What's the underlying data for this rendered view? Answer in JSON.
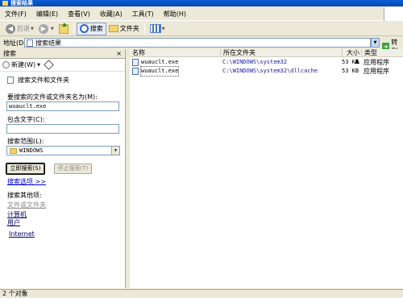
{
  "window": {
    "title": "搜索结果"
  },
  "menu": [
    "文件(F)",
    "编辑(E)",
    "查看(V)",
    "收藏(A)",
    "工具(T)",
    "帮助(H)"
  ],
  "toolbar": {
    "back": "后退",
    "search": "搜索",
    "folders": "文件夹"
  },
  "address": {
    "label": "地址(D)",
    "value": "搜索结果",
    "go": "转到"
  },
  "pane": {
    "title": "搜索",
    "close": "×",
    "new_label": "新建(W)",
    "criteria_label": "搜索文件和文件夹",
    "name_label": "要搜索的文件或文件夹名为(M):",
    "name_value": "wuauclt.exe",
    "text_label": "包含文字(C):",
    "text_value": "",
    "scope_label": "搜索范围(L):",
    "scope_value": "WINDOWS",
    "search_now": "立即搜索(S)",
    "stop": "停止搜索(T)",
    "options": "搜索选项 >>",
    "other_label": "搜索其他项:",
    "other_items": [
      "文件或文件夹",
      "计算机",
      "用户"
    ],
    "internet": "Internet"
  },
  "results": {
    "columns": [
      "名称",
      "所在文件夹",
      "大小",
      "类型"
    ],
    "sort_indicator": "▲",
    "rows": [
      {
        "name": "wuauclt.exe",
        "folder": "C:\\WINDOWS\\system32",
        "size": "53 KB",
        "type": "应用程序"
      },
      {
        "name": "wuauclt.exe",
        "folder": "C:\\WINDOWS\\system32\\dllcache",
        "size": "53 KB",
        "type": "应用程序"
      }
    ]
  },
  "status": {
    "text": "2 个对象"
  }
}
